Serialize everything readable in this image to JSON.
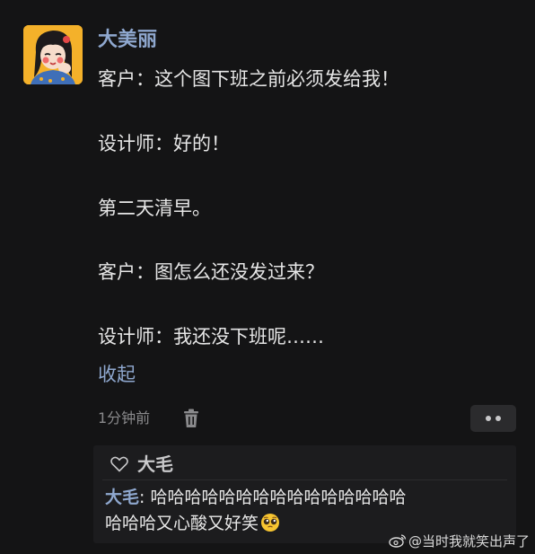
{
  "post": {
    "username": "大美丽",
    "lines": [
      "客户：这个图下班之前必须发给我！",
      "设计师：好的！",
      "第二天清早。",
      "客户：图怎么还没发过来？",
      "设计师：我还没下班呢……"
    ],
    "collapse_label": "收起",
    "time": "1分钟前",
    "avatar_icon": "cartoon-girl-avatar",
    "more_icon": "more-dots-icon",
    "delete_icon": "trash-icon"
  },
  "reply": {
    "liker_name": "大毛",
    "author": "大毛",
    "separator": ": ",
    "text_line1": "哈哈哈哈哈哈哈哈哈哈哈哈哈哈哈",
    "text_line2": "哈哈哈又心酸又好笑",
    "emoji": "pleading-face-emoji"
  },
  "watermark": {
    "text": "@当时我就笑出声了",
    "icon": "weibo-logo"
  },
  "colors": {
    "background": "#141415",
    "link_blue": "#8fa8cf",
    "text": "#e6e6e6",
    "muted": "#8a8a8c",
    "reply_bg": "#1c1c1e"
  }
}
